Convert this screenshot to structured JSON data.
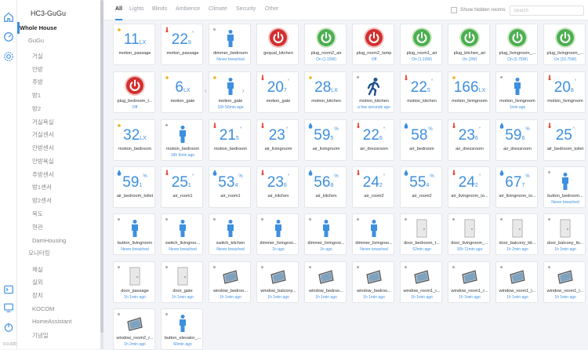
{
  "app": {
    "version": "0.0.030"
  },
  "sidebar": {
    "title": "HC3-GuGu",
    "items": [
      {
        "label": "Whole House",
        "indent": 3,
        "active": true
      },
      {
        "label": "GuGu",
        "indent": 14
      },
      {
        "label": "거실",
        "indent": 19
      },
      {
        "label": "안방",
        "indent": 19
      },
      {
        "label": "주방",
        "indent": 19
      },
      {
        "label": "방1",
        "indent": 19
      },
      {
        "label": "방2",
        "indent": 19
      },
      {
        "label": "거실욕실",
        "indent": 19
      },
      {
        "label": "거실센서",
        "indent": 19
      },
      {
        "label": "안방센서",
        "indent": 19
      },
      {
        "label": "안방욕실",
        "indent": 19
      },
      {
        "label": "주방센서",
        "indent": 19
      },
      {
        "label": "방1센서",
        "indent": 19
      },
      {
        "label": "방2센서",
        "indent": 19
      },
      {
        "label": "복도",
        "indent": 19
      },
      {
        "label": "현관",
        "indent": 19
      },
      {
        "label": "DamHousing",
        "indent": 19
      },
      {
        "label": "모니터링",
        "indent": 14
      },
      {
        "label": "체실",
        "indent": 19
      },
      {
        "label": "실외",
        "indent": 19
      },
      {
        "label": "장치",
        "indent": 19
      },
      {
        "label": "KOCOM",
        "indent": 19
      },
      {
        "label": "HomeAssistant",
        "indent": 19
      },
      {
        "label": "기념일",
        "indent": 19
      }
    ]
  },
  "rail": {
    "icons": [
      "home-icon",
      "dashboard-icon",
      "settings-icon",
      "terminal-icon",
      "monitor-icon",
      "power-icon"
    ]
  },
  "tabs": [
    "All",
    "Lights",
    "Blinds",
    "Ambience",
    "Climate",
    "Security",
    "Other"
  ],
  "hidden_rooms_label": "Show hidden rooms",
  "search": {
    "placeholder": "Search",
    "value": ""
  },
  "colors": {
    "accent": "#3d8fe0",
    "on": "#4caf50",
    "off": "#d32f2f"
  },
  "cards": [
    {
      "kind": "num",
      "badge": "sun",
      "value": "11",
      "unit": "LX",
      "name": "motion_passage"
    },
    {
      "kind": "num",
      "badge": "therm",
      "value": "22",
      "dec": "9",
      "deg": true,
      "name": "motion_passage"
    },
    {
      "kind": "person",
      "badge": "dot",
      "name": "dimmer_bedroom",
      "sub": "Never breached"
    },
    {
      "kind": "power",
      "on": false,
      "name": "goqual_kitchen"
    },
    {
      "kind": "power",
      "on": true,
      "name": "plug_room2_air",
      "sub": "On (1.19W)"
    },
    {
      "kind": "power",
      "on": false,
      "name": "plug_room2_lamp",
      "sub": "Off"
    },
    {
      "kind": "power",
      "on": true,
      "name": "plug_room1_air",
      "sub": "On (1.19W)"
    },
    {
      "kind": "power",
      "on": true,
      "name": "plug_kitchen_air",
      "sub": "On (2W)"
    },
    {
      "kind": "power",
      "on": true,
      "name": "plug_livingroom_...",
      "sub": "On (0.75W)"
    },
    {
      "kind": "power",
      "on": true,
      "name": "plug_livingroom_...",
      "sub": "On (15.75W)"
    },
    {
      "kind": "power",
      "on": false,
      "name": "plug_bedroom_t...",
      "sub": "Off"
    },
    {
      "kind": "num",
      "badge": "sun",
      "value": "6",
      "unit": "LX",
      "name": "motion_gate"
    },
    {
      "kind": "person",
      "badge": "sun",
      "name": "motion_gate",
      "sub": "16h 56min ago"
    },
    {
      "kind": "num",
      "badge": "therm",
      "value": "20",
      "dec": "7",
      "deg": true,
      "name": "motion_gate"
    },
    {
      "kind": "num",
      "badge": "sun",
      "value": "28",
      "unit": "LX",
      "name": "motion_kitchen"
    },
    {
      "kind": "run",
      "badge": "dot",
      "name": "motion_kitchen",
      "sub": "a few seconds ago"
    },
    {
      "kind": "num",
      "badge": "therm",
      "value": "22",
      "dec": "5",
      "deg": true,
      "name": "motion_kitchen"
    },
    {
      "kind": "num",
      "badge": "sun",
      "value": "166",
      "unit": "LX",
      "name": "motion_livingroom"
    },
    {
      "kind": "person",
      "badge": "dot",
      "name": "motion_livingroom",
      "sub": "1min ago"
    },
    {
      "kind": "num",
      "badge": "therm",
      "value": "20",
      "dec": "8",
      "deg": true,
      "name": "motion_livingroom"
    },
    {
      "kind": "num",
      "badge": "sun",
      "value": "32",
      "unit": "LX",
      "name": "motion_bedroom"
    },
    {
      "kind": "person",
      "badge": "dot",
      "name": "motion_bedroom",
      "sub": "16h 6min ago"
    },
    {
      "kind": "num",
      "badge": "therm",
      "value": "21",
      "dec": "5",
      "deg": true,
      "name": "motion_bedroom"
    },
    {
      "kind": "num",
      "badge": "therm",
      "value": "23",
      "deg": true,
      "name": "air_livingroom"
    },
    {
      "kind": "num",
      "badge": "drop",
      "value": "59",
      "dec": "5",
      "pct": true,
      "name": "air_livingroom"
    },
    {
      "kind": "num",
      "badge": "therm",
      "value": "22",
      "dec": "6",
      "deg": true,
      "name": "air_dressroom"
    },
    {
      "kind": "num",
      "badge": "drop",
      "value": "58",
      "pct": true,
      "name": "air_bedroom"
    },
    {
      "kind": "num",
      "badge": "therm",
      "value": "23",
      "dec": "6",
      "deg": true,
      "name": "air_dressroom"
    },
    {
      "kind": "num",
      "badge": "drop",
      "value": "59",
      "dec": "6",
      "pct": true,
      "name": "air_dressroom"
    },
    {
      "kind": "num",
      "badge": "therm",
      "value": "25",
      "deg": true,
      "name": "air_bedroom_toilet"
    },
    {
      "kind": "num",
      "badge": "drop",
      "value": "59",
      "dec": "1",
      "pct": true,
      "name": "air_bedroom_toilet"
    },
    {
      "kind": "num",
      "badge": "therm",
      "value": "25",
      "dec": "1",
      "deg": true,
      "name": "air_room1"
    },
    {
      "kind": "num",
      "badge": "drop",
      "value": "53",
      "dec": "4",
      "pct": true,
      "name": "air_room1"
    },
    {
      "kind": "num",
      "badge": "therm",
      "value": "23",
      "dec": "8",
      "deg": true,
      "name": "air_kitchen"
    },
    {
      "kind": "num",
      "badge": "drop",
      "value": "56",
      "dec": "8",
      "pct": true,
      "name": "air_kitchen"
    },
    {
      "kind": "num",
      "badge": "therm",
      "value": "24",
      "dec": "2",
      "deg": true,
      "name": "air_room2"
    },
    {
      "kind": "num",
      "badge": "drop",
      "value": "55",
      "dec": "4",
      "pct": true,
      "name": "air_room2"
    },
    {
      "kind": "num",
      "badge": "therm",
      "value": "24",
      "dec": "2",
      "deg": true,
      "name": "air_livingroom_to..."
    },
    {
      "kind": "num",
      "badge": "drop",
      "value": "67",
      "dec": "7",
      "pct": true,
      "name": "air_livingroom_to..."
    },
    {
      "kind": "person",
      "badge": "dot",
      "name": "button_bedroom...",
      "sub": "Never breached"
    },
    {
      "kind": "person",
      "badge": "dot",
      "name": "button_livingroom",
      "sub": "Never breached"
    },
    {
      "kind": "person",
      "badge": "dot",
      "name": "switch_livingroo...",
      "sub": "Never breached"
    },
    {
      "kind": "person",
      "badge": "dot",
      "name": "switch_kitchen",
      "sub": "Never breached"
    },
    {
      "kind": "person",
      "badge": "dot",
      "name": "dimmer_livingroo...",
      "sub": "1h ago"
    },
    {
      "kind": "person",
      "badge": "dot",
      "name": "dimmer_livingroo...",
      "sub": "1h ago"
    },
    {
      "kind": "person",
      "badge": "dot",
      "name": "dimmer_livingroo...",
      "sub": "Never breached"
    },
    {
      "kind": "door",
      "badge": "dot",
      "name": "door_bedroom_t...",
      "sub": "52min ago"
    },
    {
      "kind": "door",
      "badge": "dot",
      "name": "door_livingroom_...",
      "sub": "16h 11min ago"
    },
    {
      "kind": "door",
      "badge": "dot",
      "name": "door_balcony_kit...",
      "sub": "1h 2min ago"
    },
    {
      "kind": "door",
      "badge": "dot",
      "name": "door_balcony_liv...",
      "sub": "1h 1min ago"
    },
    {
      "kind": "door",
      "badge": "dot",
      "name": "door_passage",
      "sub": "1h 1min ago"
    },
    {
      "kind": "door",
      "badge": "dot",
      "name": "door_gate",
      "sub": "1h 1min ago"
    },
    {
      "kind": "window",
      "badge": "dot",
      "name": "window_bedroo...",
      "sub": "1h 1min ago"
    },
    {
      "kind": "window",
      "badge": "dot",
      "name": "window_balcony...",
      "sub": "1h 1min ago"
    },
    {
      "kind": "window",
      "badge": "dot",
      "name": "window_bedroo...",
      "sub": "1h 1min ago"
    },
    {
      "kind": "window",
      "badge": "dot",
      "name": "window_bedroo...",
      "sub": "1h 1min ago"
    },
    {
      "kind": "window",
      "badge": "dot",
      "name": "window_room1_r...",
      "sub": "1h 1min ago"
    },
    {
      "kind": "window",
      "badge": "dot",
      "name": "window_room1_r...",
      "sub": "1h 1min ago"
    },
    {
      "kind": "window",
      "badge": "dot",
      "name": "window_room1_l...",
      "sub": "1h 1min ago"
    },
    {
      "kind": "window",
      "badge": "dot",
      "name": "window_room1_l...",
      "sub": "1h 1min ago"
    },
    {
      "kind": "window",
      "badge": "dot",
      "name": "window_room2_r...",
      "sub": "1h 2min ago"
    },
    {
      "kind": "person",
      "badge": "dot",
      "name": "button_elevator_...",
      "sub": "60min ago"
    }
  ]
}
